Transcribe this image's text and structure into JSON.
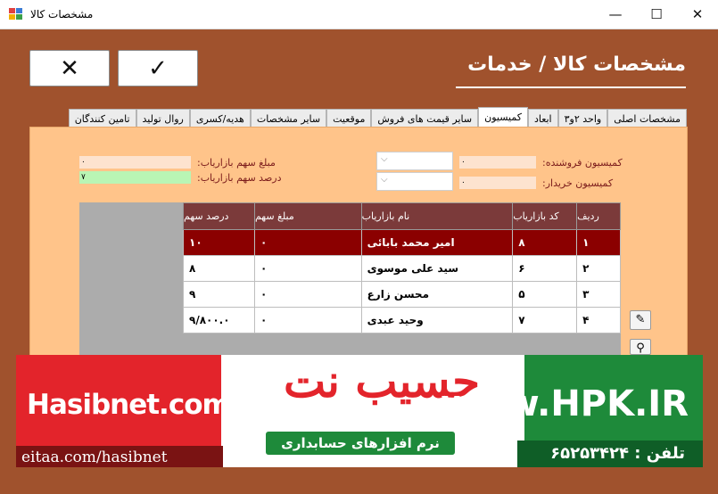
{
  "window": {
    "title": "مشخصات کالا"
  },
  "controls": {
    "minimize": "—",
    "maximize": "☐",
    "close": "✕"
  },
  "buttons": {
    "cancel": "✕",
    "ok": "✓"
  },
  "page_title": "مشخصات کالا / خدمات",
  "tabs": [
    "مشخصات اصلی",
    "واحد ۲و۳",
    "ابعاد",
    "کمیسیون",
    "سایر قیمت های فروش",
    "موقعیت",
    "سایر مشخصات",
    "هدیه/کسری",
    "روال تولید",
    "تامین کنندگان"
  ],
  "active_tab": "کمیسیون",
  "form": {
    "seller_commission_label": "کمیسیون فروشنده:",
    "seller_commission_value": "۰",
    "buyer_commission_label": "کمیسیون خریدار:",
    "buyer_commission_value": "۰",
    "marketer_share_amount_label": "مبلغ سهم بازاریاب:",
    "marketer_share_amount_value": "۰",
    "marketer_share_percent_label": "درصد سهم بازاریاب:",
    "marketer_share_percent_value": "۷"
  },
  "grid": {
    "headers": [
      "ردیف",
      "کد بازاریاب",
      "نام بازاریاب",
      "مبلغ سهم",
      "درصد سهم"
    ],
    "rows": [
      {
        "radif": "۱",
        "code": "۸",
        "name": "امیر محمد بابائی",
        "amount": "۰",
        "percent": "۱۰"
      },
      {
        "radif": "۲",
        "code": "۶",
        "name": "سید علی موسوی",
        "amount": "۰",
        "percent": "۸"
      },
      {
        "radif": "۳",
        "code": "۵",
        "name": "محسن زارع",
        "amount": "۰",
        "percent": "۹"
      },
      {
        "radif": "۴",
        "code": "۷",
        "name": "وحید عبدی",
        "amount": "۰",
        "percent": "۹/۸۰۰.۰"
      }
    ]
  },
  "banner": {
    "site": "Hasibnet.com",
    "eitaa": "eitaa.com/hasibnet",
    "brand": "حسیب نت",
    "slogan": "نرم افزارهای حسابداری",
    "hpk": "www.HPK.IR",
    "phone": "تلفن : ۶۵۲۵۳۴۲۴"
  },
  "colors": {
    "background": "#a0522d",
    "panel": "#ffc48a",
    "selected_row": "#8b0000",
    "header": "#7b3a3a"
  }
}
